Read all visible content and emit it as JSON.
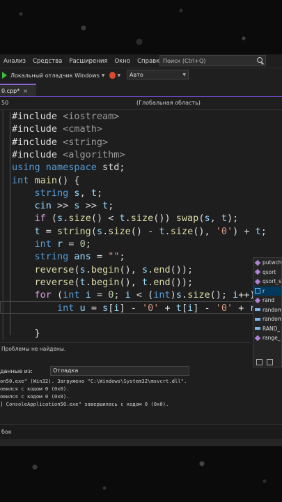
{
  "menu": {
    "items": [
      "Анализ",
      "Средства",
      "Расширения",
      "Окно",
      "Справка"
    ],
    "search_placeholder": "Поиск (Ctrl+Q)"
  },
  "toolbar": {
    "debugger_label": "Локальный отладчик Windows",
    "config_value": "Авто"
  },
  "tab": {
    "title": "0.cpp*",
    "close": "×"
  },
  "navbar": {
    "left": "50",
    "scope": "(Глобальная область)"
  },
  "code": [
    [
      [
        "pl",
        "#include "
      ],
      [
        "inc",
        "<iostream>"
      ]
    ],
    [
      [
        "pl",
        "#include "
      ],
      [
        "inc",
        "<cmath>"
      ]
    ],
    [
      [
        "pl",
        "#include "
      ],
      [
        "inc",
        "<string>"
      ]
    ],
    [
      [
        "pl",
        "#include "
      ],
      [
        "inc",
        "<algorithm>"
      ]
    ],
    [
      [
        "kw",
        "using namespace "
      ],
      [
        "pl",
        "std;"
      ]
    ],
    [
      [
        "kw",
        "int "
      ],
      [
        "fn",
        "main"
      ],
      [
        "pl",
        "() {"
      ]
    ],
    [
      [
        "pl",
        "    "
      ],
      [
        "kw",
        "string "
      ],
      [
        "var",
        "s"
      ],
      [
        "pl",
        ", "
      ],
      [
        "var",
        "t"
      ],
      [
        "pl",
        ";"
      ]
    ],
    [
      [
        "pl",
        "    "
      ],
      [
        "var",
        "cin"
      ],
      [
        "pl",
        " >> "
      ],
      [
        "var",
        "s"
      ],
      [
        "pl",
        " >> "
      ],
      [
        "var",
        "t"
      ],
      [
        "pl",
        ";"
      ]
    ],
    [
      [
        "pl",
        "    "
      ],
      [
        "kw2",
        "if"
      ],
      [
        "pl",
        " ("
      ],
      [
        "var",
        "s"
      ],
      [
        "pl",
        "."
      ],
      [
        "fn",
        "size"
      ],
      [
        "pl",
        "() < "
      ],
      [
        "var",
        "t"
      ],
      [
        "pl",
        "."
      ],
      [
        "fn",
        "size"
      ],
      [
        "pl",
        "()) "
      ],
      [
        "fn",
        "swap"
      ],
      [
        "pl",
        "("
      ],
      [
        "var",
        "s"
      ],
      [
        "pl",
        ", "
      ],
      [
        "var",
        "t"
      ],
      [
        "pl",
        ");"
      ]
    ],
    [
      [
        "pl",
        "    "
      ],
      [
        "var",
        "t"
      ],
      [
        "pl",
        " = "
      ],
      [
        "fn",
        "string"
      ],
      [
        "pl",
        "("
      ],
      [
        "var",
        "s"
      ],
      [
        "pl",
        "."
      ],
      [
        "fn",
        "size"
      ],
      [
        "pl",
        "() - "
      ],
      [
        "var",
        "t"
      ],
      [
        "pl",
        "."
      ],
      [
        "fn",
        "size"
      ],
      [
        "pl",
        "(), "
      ],
      [
        "str",
        "'0'"
      ],
      [
        "pl",
        ") + "
      ],
      [
        "var",
        "t"
      ],
      [
        "pl",
        ";"
      ]
    ],
    [
      [
        "pl",
        "    "
      ],
      [
        "kw",
        "int "
      ],
      [
        "var",
        "r"
      ],
      [
        "pl",
        " = "
      ],
      [
        "num",
        "0"
      ],
      [
        "pl",
        ";"
      ]
    ],
    [
      [
        "pl",
        "    "
      ],
      [
        "kw",
        "string "
      ],
      [
        "var",
        "ans"
      ],
      [
        "pl",
        " = "
      ],
      [
        "str",
        "\"\""
      ],
      [
        "pl",
        ";"
      ]
    ],
    [
      [
        "pl",
        "    "
      ],
      [
        "fn",
        "reverse"
      ],
      [
        "pl",
        "("
      ],
      [
        "var",
        "s"
      ],
      [
        "pl",
        "."
      ],
      [
        "fn",
        "begin"
      ],
      [
        "pl",
        "(), "
      ],
      [
        "var",
        "s"
      ],
      [
        "pl",
        "."
      ],
      [
        "fn",
        "end"
      ],
      [
        "pl",
        "());"
      ]
    ],
    [
      [
        "pl",
        "    "
      ],
      [
        "fn",
        "reverse"
      ],
      [
        "pl",
        "("
      ],
      [
        "var",
        "t"
      ],
      [
        "pl",
        "."
      ],
      [
        "fn",
        "begin"
      ],
      [
        "pl",
        "(), "
      ],
      [
        "var",
        "t"
      ],
      [
        "pl",
        "."
      ],
      [
        "fn",
        "end"
      ],
      [
        "pl",
        "());"
      ]
    ],
    [
      [
        "pl",
        "    "
      ],
      [
        "kw2",
        "for"
      ],
      [
        "pl",
        " ("
      ],
      [
        "kw",
        "int "
      ],
      [
        "var",
        "i"
      ],
      [
        "pl",
        " = "
      ],
      [
        "num",
        "0"
      ],
      [
        "pl",
        "; "
      ],
      [
        "var",
        "i"
      ],
      [
        "pl",
        " < ("
      ],
      [
        "kw",
        "int"
      ],
      [
        "pl",
        ")"
      ],
      [
        "var",
        "s"
      ],
      [
        "pl",
        "."
      ],
      [
        "fn",
        "size"
      ],
      [
        "pl",
        "(); "
      ],
      [
        "var",
        "i"
      ],
      [
        "pl",
        "++) {"
      ]
    ],
    [
      [
        "pl",
        "        "
      ],
      [
        "kw",
        "int "
      ],
      [
        "var",
        "u"
      ],
      [
        "pl",
        " = "
      ],
      [
        "var",
        "s"
      ],
      [
        "pl",
        "["
      ],
      [
        "var",
        "i"
      ],
      [
        "pl",
        "] - "
      ],
      [
        "str",
        "'0'"
      ],
      [
        "pl",
        " + "
      ],
      [
        "var",
        "t"
      ],
      [
        "pl",
        "["
      ],
      [
        "var",
        "i"
      ],
      [
        "pl",
        "] - "
      ],
      [
        "str",
        "'0'"
      ],
      [
        "pl",
        " + "
      ],
      [
        "var",
        "r"
      ],
      [
        "pl",
        ";"
      ]
    ],
    [
      [
        "pl",
        ""
      ]
    ],
    [
      [
        "pl",
        "    }"
      ]
    ]
  ],
  "status": {
    "problems": "Проблемы не найдены."
  },
  "output": {
    "label": "данные из:",
    "source": "Отладка",
    "lines": [
      "on50.exe\" (Win32). Загружено \"C:\\Windows\\System32\\msvcrt.dll\".",
      "овился с кодом 0 (0x0).",
      "овился с кодом 0 (0x0).",
      "] ConsoleApplication50.exe\" завершилась с кодом 0 (0x0)."
    ]
  },
  "bottom": {
    "label": "бок"
  },
  "completion": {
    "items": [
      {
        "label": "putwch",
        "icon": "func"
      },
      {
        "label": "qsort",
        "icon": "func"
      },
      {
        "label": "qsort_s",
        "icon": "func"
      },
      {
        "label": "r",
        "icon": "var",
        "selected": true
      },
      {
        "label": "rand",
        "icon": "func"
      },
      {
        "label": "random",
        "icon": "mac"
      },
      {
        "label": "random",
        "icon": "mac"
      },
      {
        "label": "RAND_",
        "icon": "mac"
      },
      {
        "label": "range_",
        "icon": "func"
      }
    ]
  }
}
